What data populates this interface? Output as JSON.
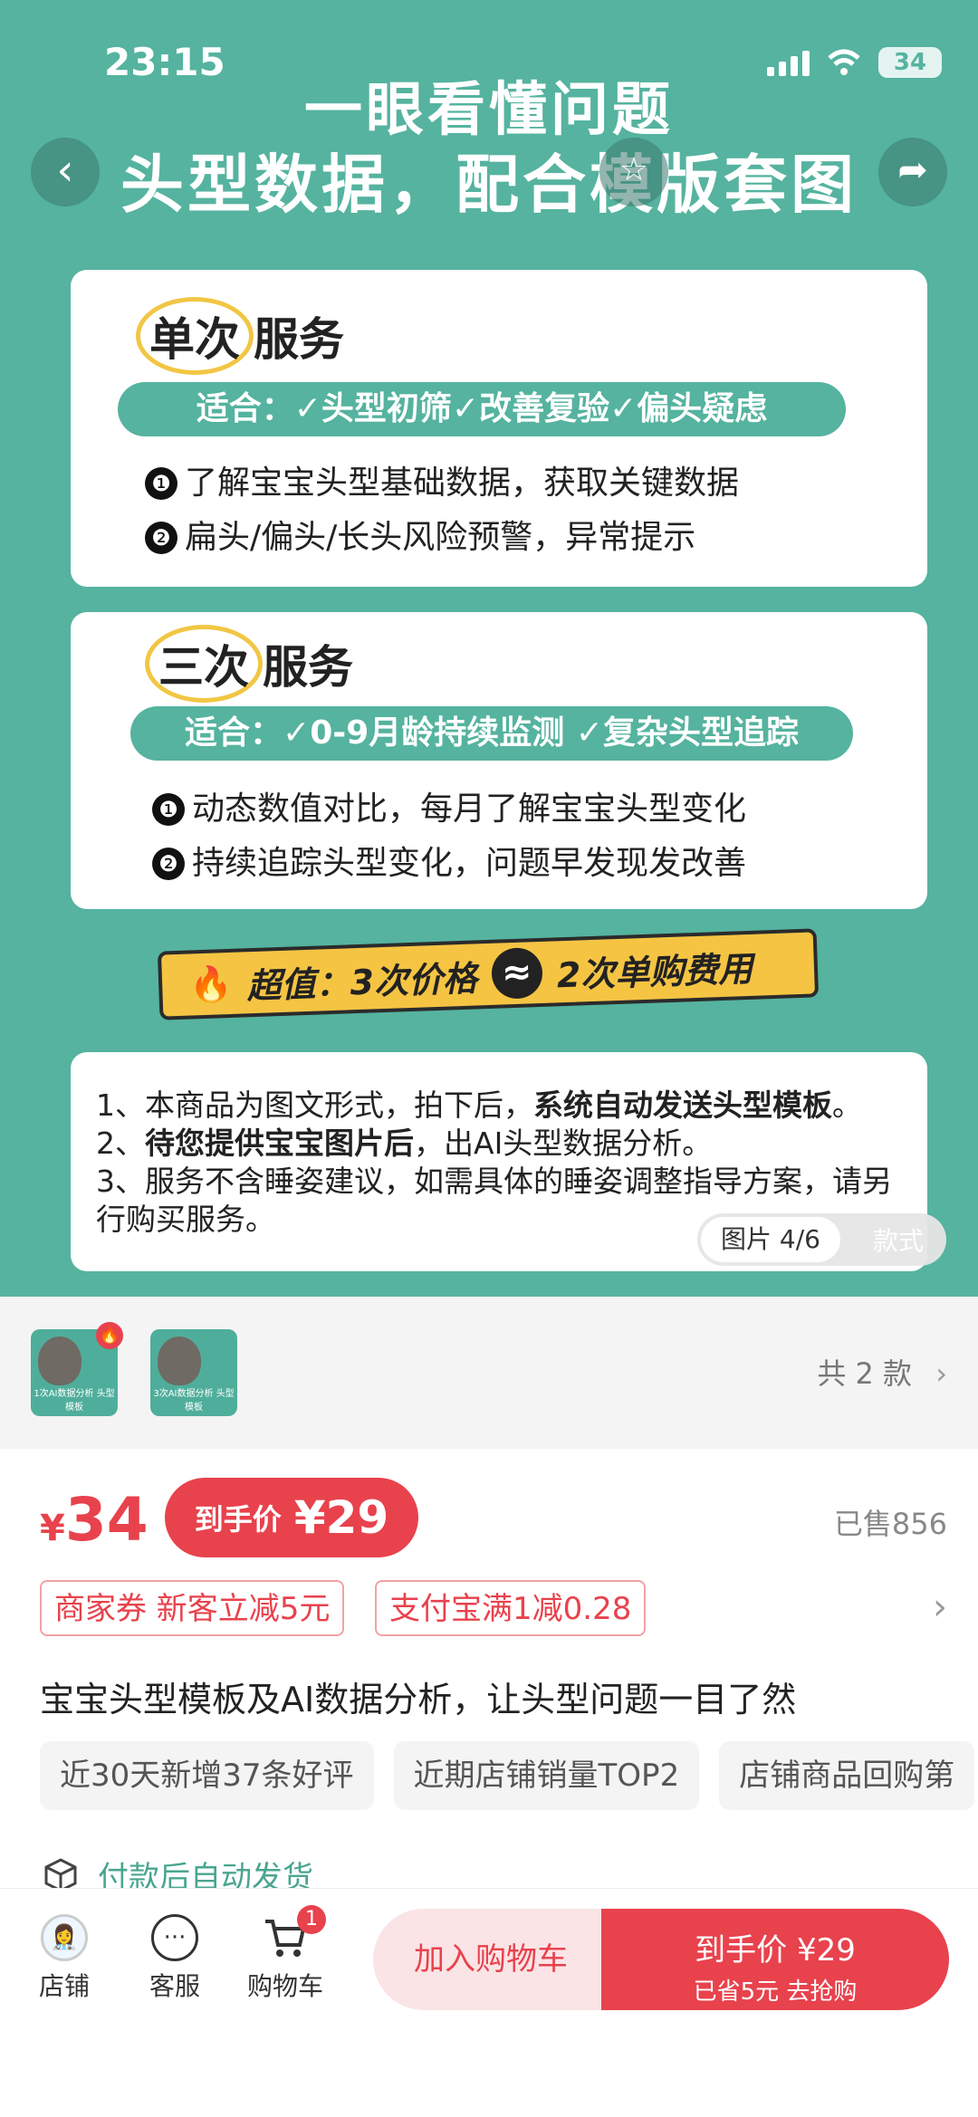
{
  "status": {
    "time": "23:15",
    "battery": "34"
  },
  "hero": {
    "headline1": "一眼看懂问题",
    "headline2": "头型数据，配合模版套图",
    "card1": {
      "title_highlight": "单次",
      "title_rest": "服务",
      "suitable": "适合：✓头型初筛✓改善复验✓偏头疑虑",
      "points": [
        "了解宝宝头型基础数据，获取关键数据",
        "扁头/偏头/长头风险预警，异常提示"
      ]
    },
    "card2": {
      "title_highlight": "三次",
      "title_rest": "服务",
      "suitable": "适合：✓0-9月龄持续监测 ✓复杂头型追踪",
      "points": [
        "动态数值对比，每月了解宝宝头型变化",
        "持续追踪头型变化，问题早发现发改善"
      ]
    },
    "deal": {
      "left": "超值：3次价格",
      "symbol": "≈",
      "right": "2次单购费用"
    },
    "notes": {
      "line1_a": "1、本商品为图文形式，拍下后，",
      "line1_b": "系统自动发送头型模板",
      "line1_c": "。",
      "line2_a": "2、",
      "line2_b": "待您提供宝宝图片后",
      "line2_c": "，出AI头型数据分析。",
      "line3": "3、服务不含睡姿建议，如需具体的睡姿调整指导方案，请另行购买服务。"
    },
    "counter": {
      "current": "图片 4/6",
      "other": "款式"
    },
    "number_marks": [
      "❶",
      "❷"
    ]
  },
  "variants": {
    "thumb_text": "1次AI数据分析 头型模板",
    "thumb_text2": "3次AI数据分析 头型模板",
    "total": "共 2 款"
  },
  "price": {
    "currency": "¥",
    "value": "34",
    "final_label": "到手价",
    "final_value": "¥29",
    "sold": "已售856"
  },
  "coupons": [
    "商家券 新客立减5元",
    "支付宝满1减0.28"
  ],
  "product_title": "宝宝头型模板及AI数据分析，让头型问题一目了然",
  "tags": [
    "近30天新增37条好评",
    "近期店铺销量TOP2",
    "店铺商品回购第"
  ],
  "shipping": "付款后自动发货",
  "bottom": {
    "shop": "店铺",
    "service": "客服",
    "cart": "购物车",
    "cart_badge": "1",
    "add_cart": "加入购物车",
    "buy_title": "到手价 ¥29",
    "buy_sub": "已省5元 去抢购"
  },
  "colors": {
    "accent": "#e8424d",
    "hero_bg": "#55b39f",
    "deal": "#f5c443"
  }
}
